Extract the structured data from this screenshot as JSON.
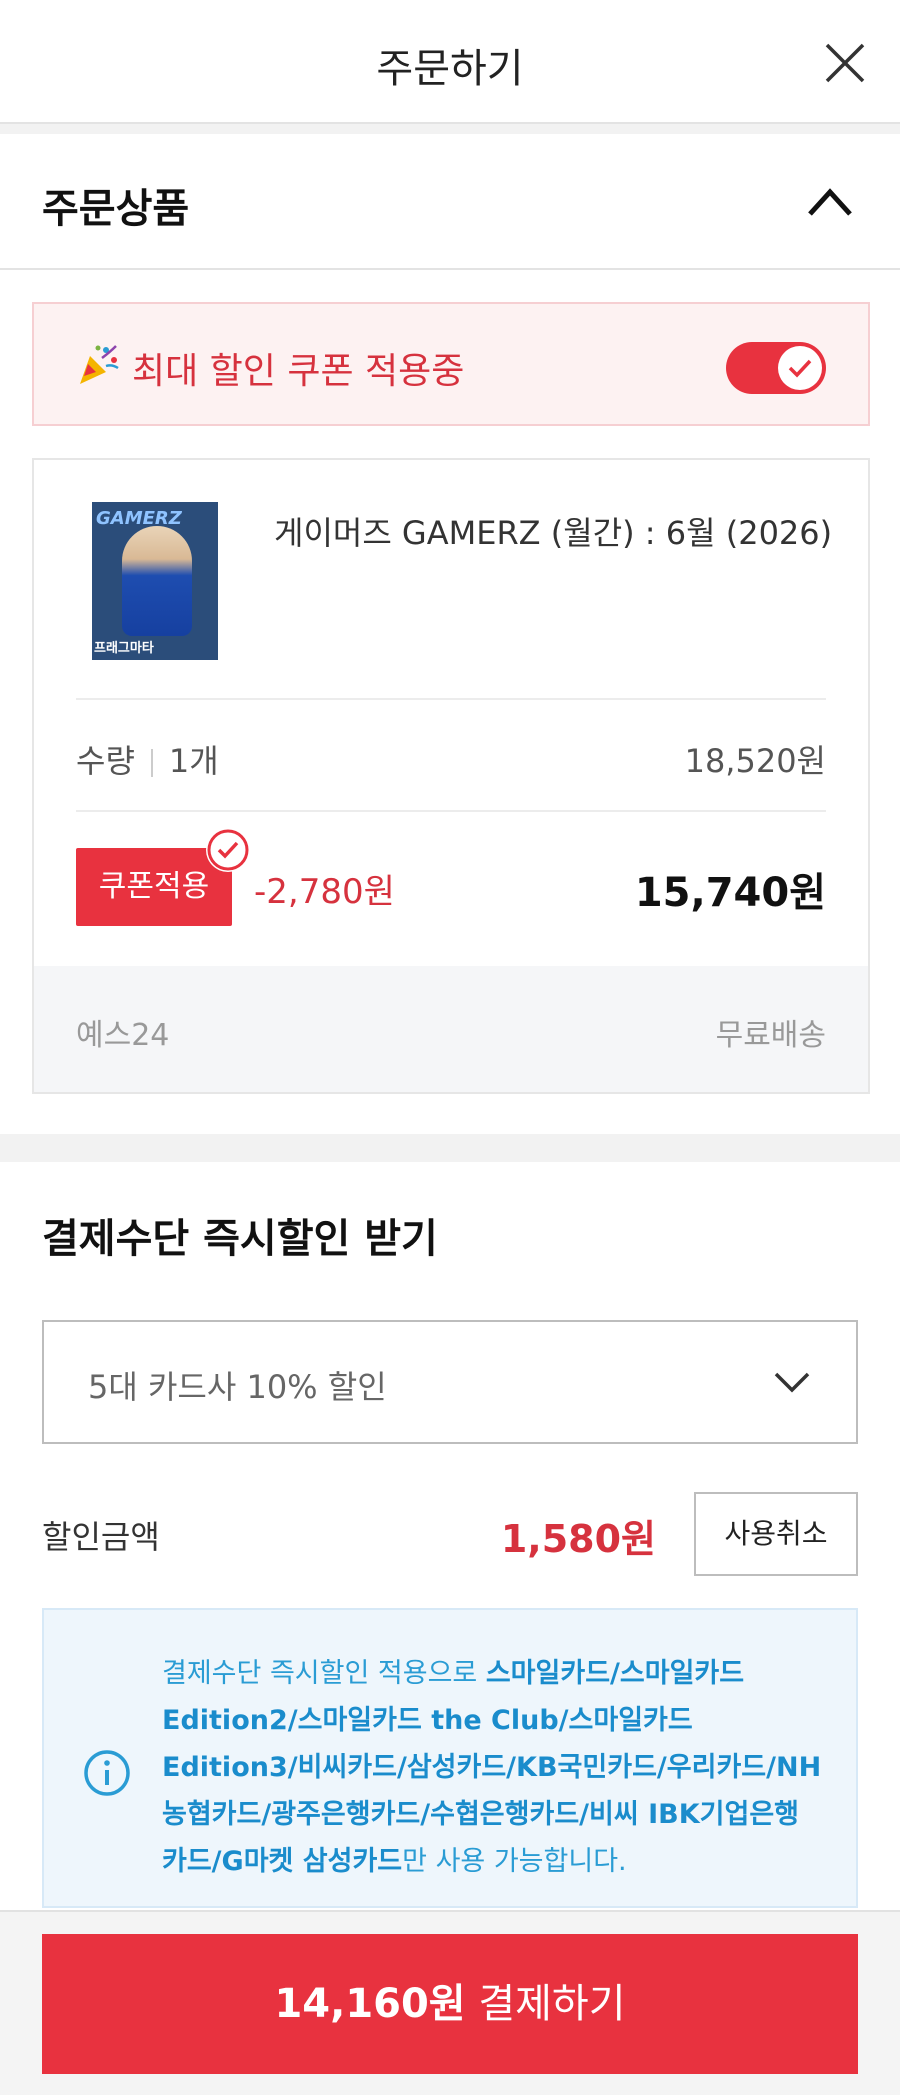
{
  "header": {
    "title": "주문하기",
    "close_icon": "close-icon"
  },
  "order_section": {
    "title": "주문상품",
    "collapse_icon": "chevron-up-icon"
  },
  "coupon_banner": {
    "icon": "party-popper-icon",
    "text": "최대 할인 쿠폰 적용중",
    "toggle_on": true
  },
  "product": {
    "cover_title": "GAMERZ",
    "cover_caption": "프래그마타",
    "name": "게이머즈 GAMERZ (월간) : 6월 (2026)",
    "qty_label": "수량",
    "qty_value": "1개",
    "original_price": "18,520원",
    "coupon_button": "쿠폰적용",
    "discount": "-2,780원",
    "final_price": "15,740원",
    "seller": "예스24",
    "shipping": "무료배송"
  },
  "payment": {
    "title": "결제수단 즉시할인 받기",
    "select_value": "5대 카드사 10% 할인",
    "discount_label": "할인금액",
    "discount_amount": "1,580원",
    "cancel_button": "사용취소",
    "info_prefix": "결제수단 즉시할인 적용으로 ",
    "info_cards": "스마일카드/스마일카드 Edition2/스마일카드 the Club/스마일카드 Edition3/비씨카드/삼성카드/KB국민카드/우리카드/NH농협카드/광주은행카드/수협은행카드/비씨 IBK기업은행카드/G마켓 삼성카드",
    "info_suffix": "만 사용 가능합니다."
  },
  "footer": {
    "amount": "14,160원",
    "label": " 결제하기"
  },
  "colors": {
    "accent": "#e8323f",
    "info_blue": "#2a9cd4",
    "banner_bg": "#fdf2f2"
  }
}
